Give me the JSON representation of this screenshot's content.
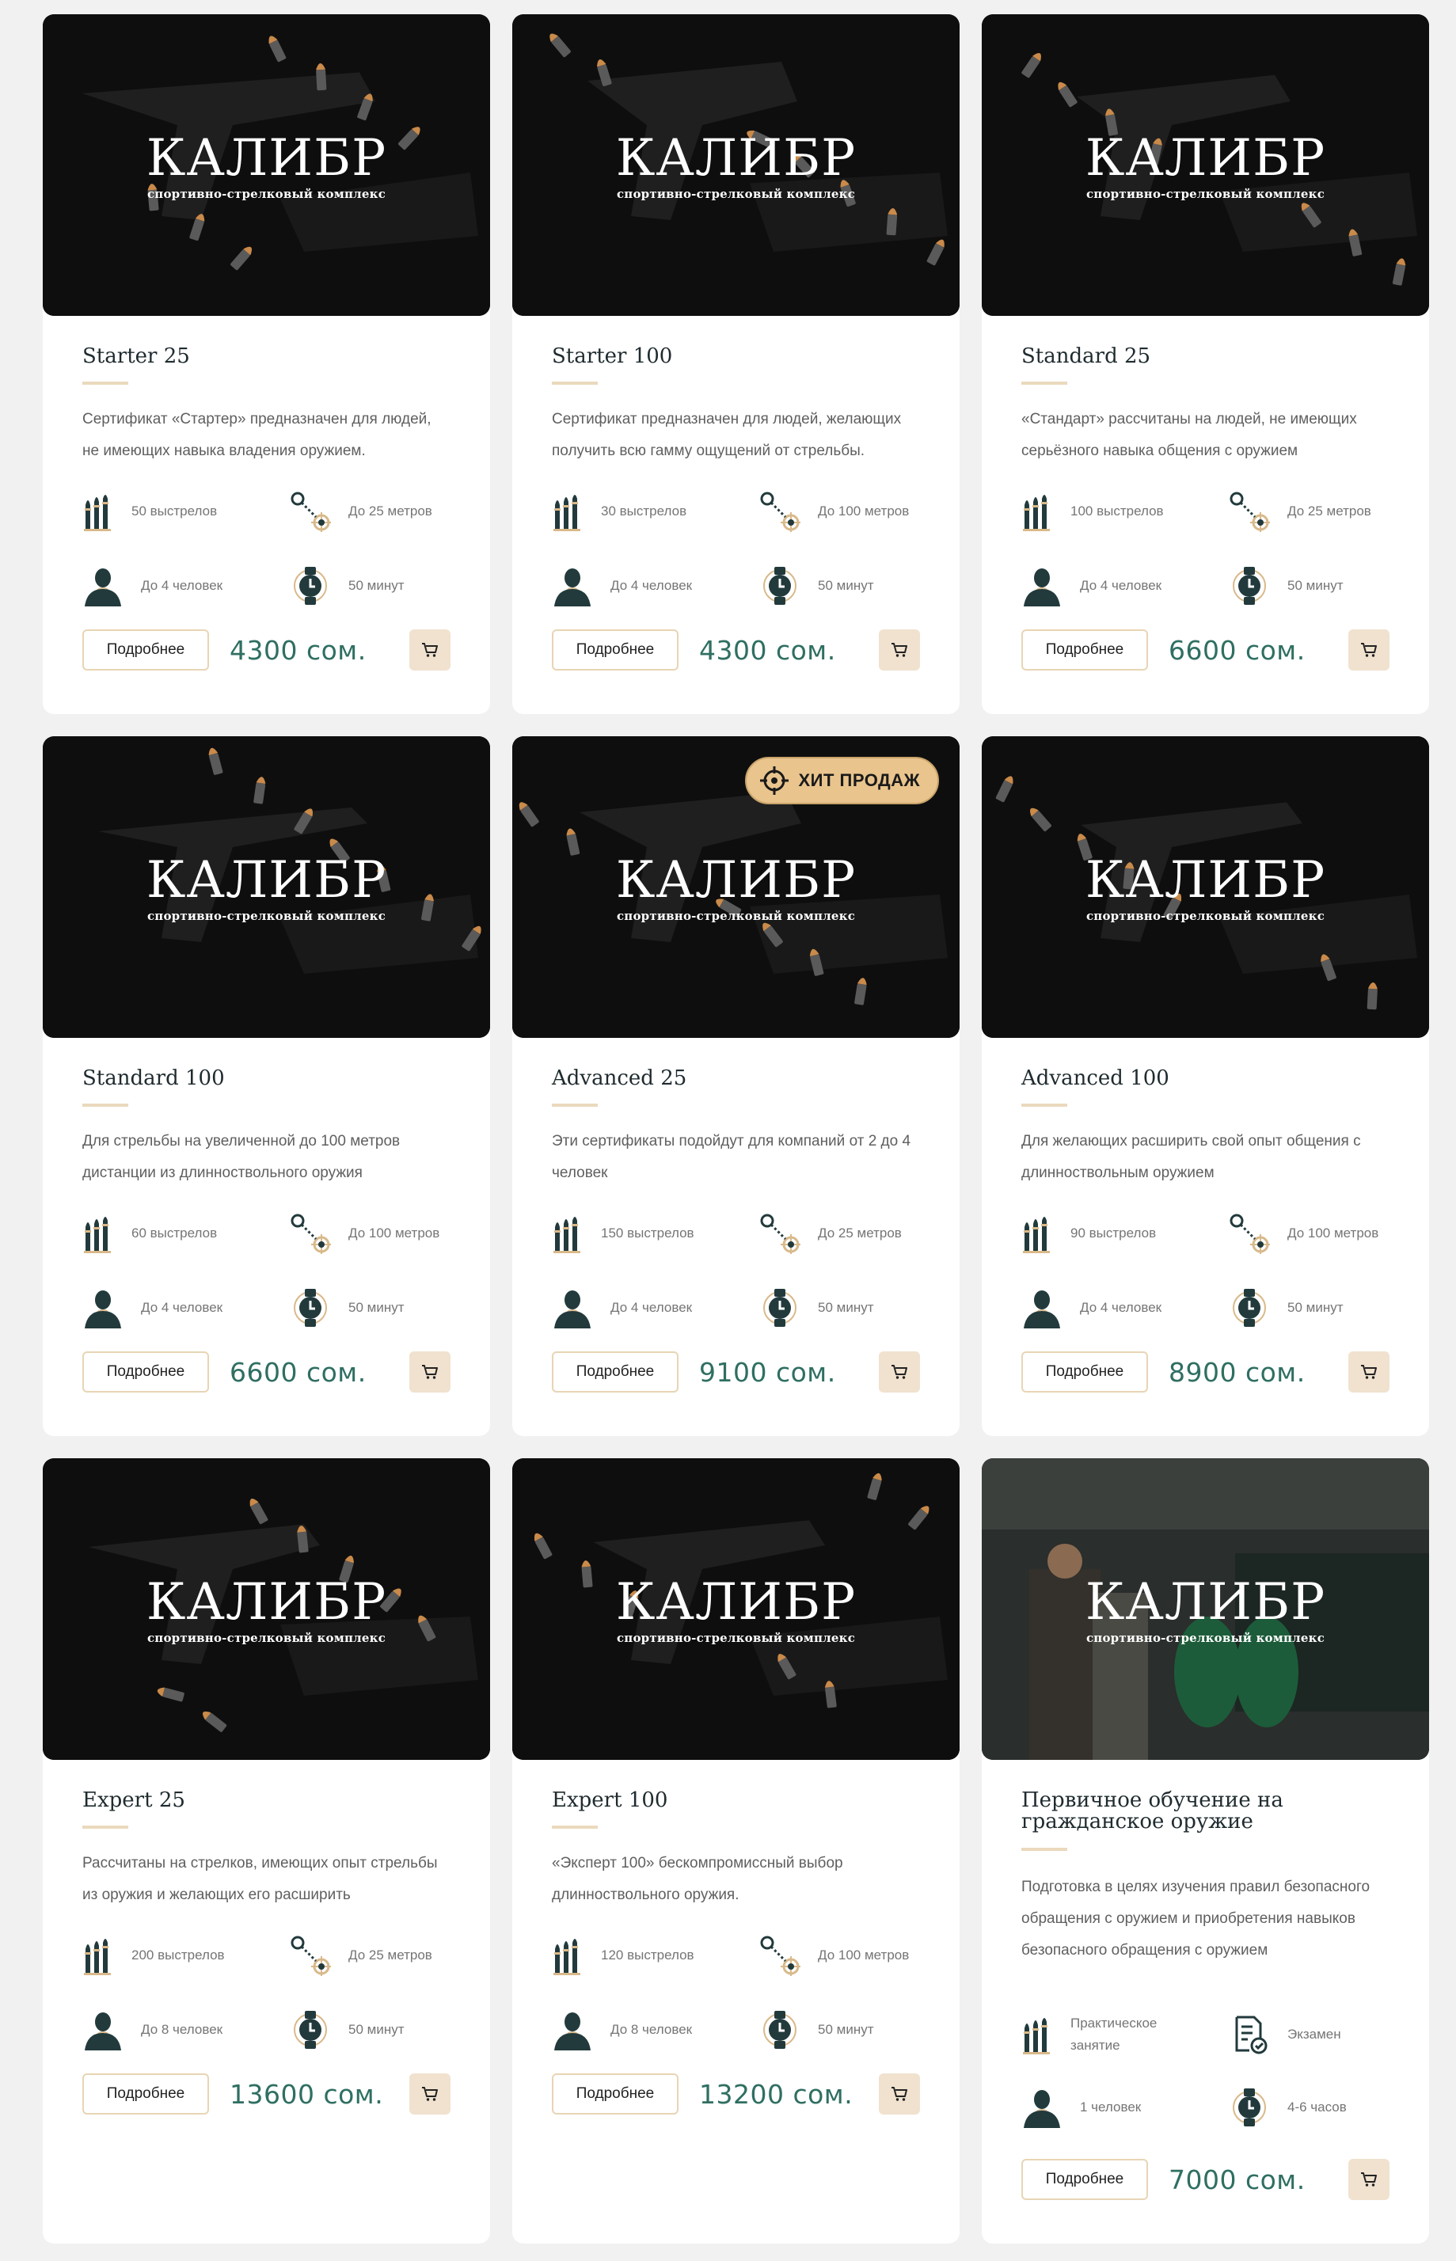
{
  "brand": {
    "name": "КАЛИБР",
    "tagline": "спортивно-стрелковый комплекс"
  },
  "more_label": "Подробнее",
  "badge_label": "ХИТ ПРОДАЖ",
  "cards": [
    {
      "title": "Starter 25",
      "desc": "Сертификат «Стартер» предназначен для людей, не имеющих навыка владения оружием.",
      "shots": "50 выстрелов",
      "distance": "До 25 метров",
      "people": "До 4 человек",
      "time": "50 минут",
      "price": "4300 сом."
    },
    {
      "title": "Starter 100",
      "desc": "Сертификат  предназначен для людей, желающих получить всю гамму ощущений от стрельбы.",
      "shots": "30 выстрелов",
      "distance": "До 100 метров",
      "people": "До 4 человек",
      "time": "50 минут",
      "price": "4300 сом."
    },
    {
      "title": "Standard 25",
      "desc": "«Стандарт» рассчитаны на людей, не имеющих серьёзного навыка общения с оружием",
      "shots": "100 выстрелов",
      "distance": "До 25 метров",
      "people": "До 4 человек",
      "time": "50 минут",
      "price": "6600 сом."
    },
    {
      "title": "Standard 100",
      "desc": "Для стрельбы на увеличенной до 100 метров дистанции из длинноствольного оружия",
      "shots": "60 выстрелов",
      "distance": "До 100 метров",
      "people": "До 4 человек",
      "time": "50 минут",
      "price": "6600 сом."
    },
    {
      "title": "Advanced 25",
      "desc": "Эти сертификаты подойдут для компаний от 2 до 4 человек",
      "shots": "150 выстрелов",
      "distance": "До 25 метров",
      "people": "До 4 человек",
      "time": "50 минут",
      "price": "9100 сом."
    },
    {
      "title": "Advanced 100",
      "desc": "Для желающих расширить свой опыт общения с длинноствольным оружием",
      "shots": "90 выстрелов",
      "distance": "До 100 метров",
      "people": "До 4 человек",
      "time": "50 минут",
      "price": "8900 сом."
    },
    {
      "title": "Expert 25",
      "desc": "Рассчитаны на стрелков, имеющих опыт стрельбы из оружия и желающих его расширить",
      "shots": "200 выстрелов",
      "distance": "До 25 метров",
      "people": "До 8 человек",
      "time": "50 минут",
      "price": "13600 сом."
    },
    {
      "title": "Expert 100",
      "desc": "«Эксперт 100» бескомпромиссный выбор длинноствольного оружия.",
      "shots": "120 выстрелов",
      "distance": "До 100 метров",
      "people": "До 8 человек",
      "time": "50 минут",
      "price": "13200 сом."
    },
    {
      "title": "Первичное обучение на гражданское оружие",
      "desc": "Подготовка в целях изучения правил безопасного обращения с оружием и приобретения навыков безопасного обращения с оружием",
      "shots": "Практическое занятие",
      "distance": "Экзамен",
      "people": "1 человек",
      "time": "4-6 часов",
      "price": "7000 сом."
    }
  ]
}
